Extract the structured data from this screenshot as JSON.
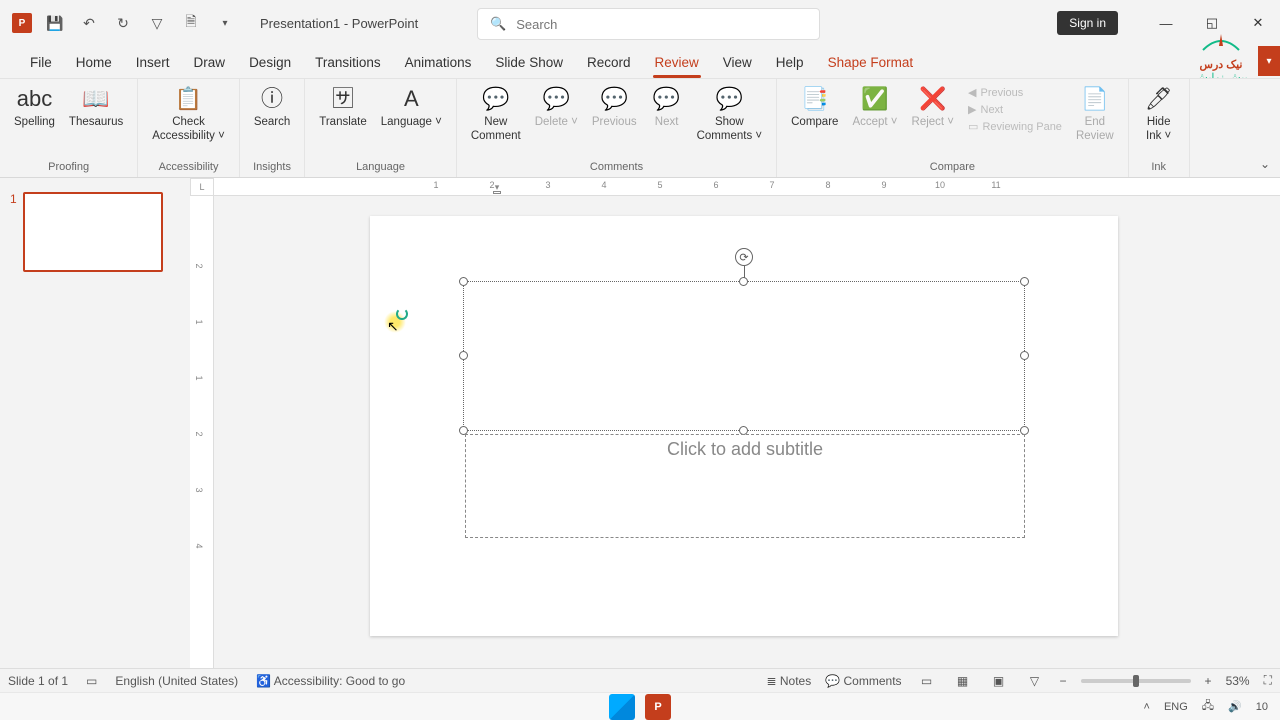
{
  "title": "Presentation1 - PowerPoint",
  "search_placeholder": "Search",
  "signin": "Sign in",
  "qat": {
    "save": "save-icon",
    "undo": "undo-icon",
    "redo": "redo-icon",
    "start": "from-beginning-icon",
    "new": "new-file-icon"
  },
  "tabs": [
    "File",
    "Home",
    "Insert",
    "Draw",
    "Design",
    "Transitions",
    "Animations",
    "Slide Show",
    "Record",
    "Review",
    "View",
    "Help",
    "Shape Format"
  ],
  "active_tab": "Review",
  "ribbon": {
    "groups": [
      {
        "name": "Proofing",
        "buttons": [
          {
            "l": "Spelling",
            "i": "abc"
          },
          {
            "l": "Thesaurus",
            "i": "📖"
          }
        ]
      },
      {
        "name": "Accessibility",
        "buttons": [
          {
            "l": "Check Accessibility",
            "i": "📋",
            "drop": true
          }
        ]
      },
      {
        "name": "Insights",
        "buttons": [
          {
            "l": "Search",
            "i": "ⓘ"
          }
        ]
      },
      {
        "name": "Language",
        "buttons": [
          {
            "l": "Translate",
            "i": "🈂"
          },
          {
            "l": "Language",
            "i": "A",
            "drop": true
          }
        ]
      },
      {
        "name": "Comments",
        "buttons": [
          {
            "l": "New Comment",
            "i": "💬"
          },
          {
            "l": "Delete",
            "i": "💬",
            "dis": true,
            "drop": true
          },
          {
            "l": "Previous",
            "i": "💬",
            "dis": true
          },
          {
            "l": "Next",
            "i": "💬",
            "dis": true
          },
          {
            "l": "Show Comments",
            "i": "💬",
            "drop": true
          }
        ]
      },
      {
        "name": "Compare",
        "buttons": [
          {
            "l": "Compare",
            "i": "📑"
          },
          {
            "l": "Accept",
            "i": "✅",
            "dis": true,
            "drop": true
          },
          {
            "l": "Reject",
            "i": "❌",
            "dis": true,
            "drop": true
          }
        ],
        "stack": [
          {
            "l": "Previous",
            "dis": true,
            "i": "◀"
          },
          {
            "l": "Next",
            "dis": true,
            "i": "▶"
          },
          {
            "l": "Reviewing Pane",
            "dis": true,
            "i": "▭"
          }
        ],
        "tail": [
          {
            "l": "End Review",
            "i": "📄",
            "dis": true
          }
        ]
      },
      {
        "name": "Ink",
        "buttons": [
          {
            "l": "Hide Ink",
            "i": "🖊",
            "drop": true
          }
        ]
      }
    ]
  },
  "ruler_h": [
    "1",
    "2",
    "3",
    "4",
    "5",
    "6",
    "7",
    "8",
    "9",
    "10",
    "11"
  ],
  "ruler_v": [
    "2",
    "1",
    "1",
    "2",
    "3",
    "4"
  ],
  "thumb_number": "1",
  "slide": {
    "subtitle_placeholder": "Click to add subtitle"
  },
  "status": {
    "slide": "Slide 1 of 1",
    "lang": "English (United States)",
    "access": "Accessibility: Good to go",
    "notes": "Notes",
    "comments": "Comments",
    "zoom": "53%"
  },
  "tray": {
    "lang": "ENG",
    "time": "10"
  },
  "logo": {
    "line1": "نیک درس",
    "line2": "پیش نمایش"
  }
}
